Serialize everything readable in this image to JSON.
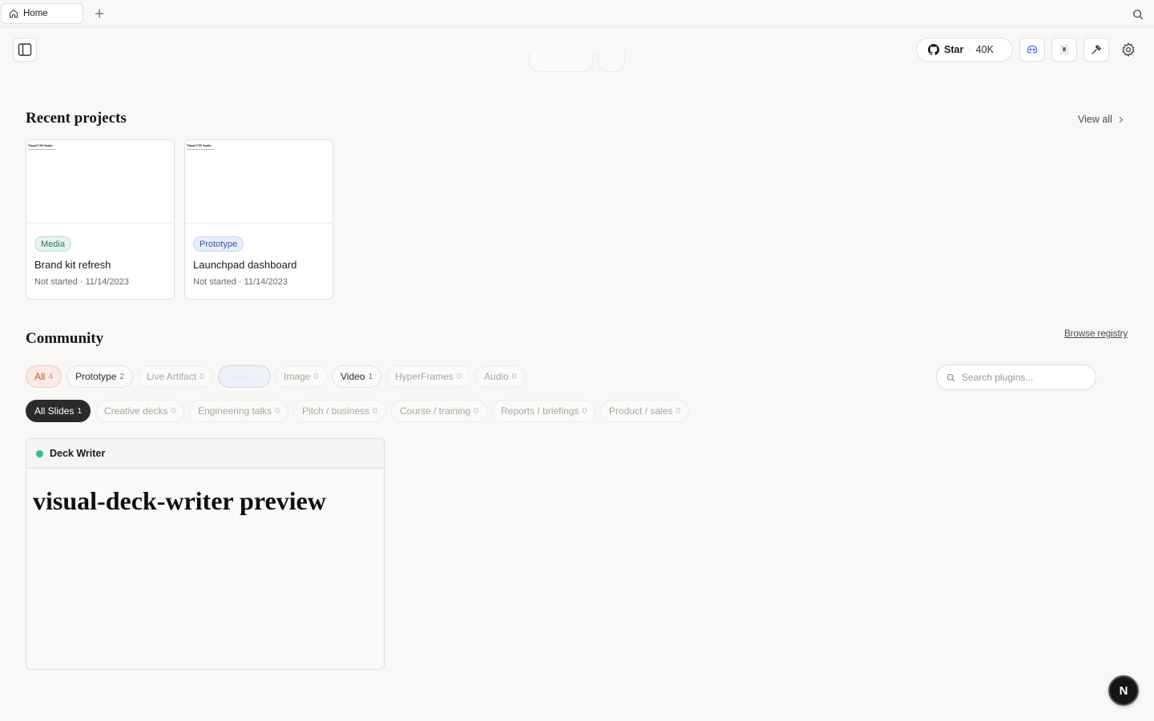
{
  "tabs": [
    {
      "label": "Home"
    }
  ],
  "header": {
    "star_label": "Star",
    "star_count": "40K"
  },
  "recent": {
    "title": "Recent projects",
    "view_all": "View all",
    "projects": [
      {
        "thumb_title": "Visual CSS Snake",
        "badge": "Media",
        "name": "Brand kit refresh",
        "status": "Not started",
        "date": "11/14/2023"
      },
      {
        "thumb_title": "Visual CSS Snake",
        "badge": "Prototype",
        "name": "Launchpad dashboard",
        "status": "Not started",
        "date": "11/14/2023"
      }
    ]
  },
  "community": {
    "title": "Community",
    "browse": "Browse registry",
    "search_placeholder": "Search plugins...",
    "type_chips": [
      {
        "label": "All",
        "count": "4"
      },
      {
        "label": "Prototype",
        "count": "2"
      },
      {
        "label": "Live Artifact",
        "count": "0"
      },
      {
        "label": "Slides",
        "count": "1"
      },
      {
        "label": "Image",
        "count": "0"
      },
      {
        "label": "Video",
        "count": "1"
      },
      {
        "label": "HyperFrames",
        "count": "0"
      },
      {
        "label": "Audio",
        "count": "0"
      }
    ],
    "sub_chips": [
      {
        "label": "All Slides",
        "count": "1"
      },
      {
        "label": "Creative decks",
        "count": "0"
      },
      {
        "label": "Engineering talks",
        "count": "0"
      },
      {
        "label": "Pitch / business",
        "count": "0"
      },
      {
        "label": "Course / training",
        "count": "0"
      },
      {
        "label": "Reports / briefings",
        "count": "0"
      },
      {
        "label": "Product / sales",
        "count": "0"
      }
    ],
    "plugin": {
      "name": "Deck Writer",
      "preview": "visual-deck-writer preview"
    }
  },
  "footer": {
    "badge": "N"
  },
  "colors": {
    "accent": "#c0533e",
    "status_green": "#34c08a"
  }
}
